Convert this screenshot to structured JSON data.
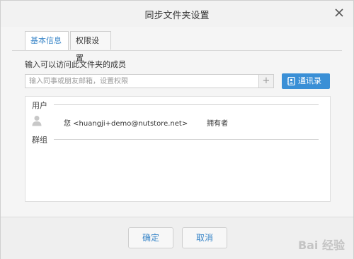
{
  "dialog": {
    "title": "同步文件夹设置",
    "close_icon": "close-icon"
  },
  "tabs": [
    {
      "label": "基本信息",
      "active": true
    },
    {
      "label": "权限设置",
      "active": false
    }
  ],
  "members": {
    "section_label": "输入可以访问此文件夹的成员",
    "input_placeholder": "输入同事或朋友邮箱，设置权限",
    "input_value": "",
    "add_label": "+",
    "contacts_label": "通讯录",
    "contacts_icon": "address-book-icon"
  },
  "list": {
    "users_title": "用户",
    "groups_title": "群组",
    "users": [
      {
        "name": "您 <huangji+demo@nutstore.net>",
        "role": "拥有者",
        "icon": "user-avatar-icon"
      }
    ]
  },
  "footer": {
    "ok_label": "确定",
    "cancel_label": "取消"
  },
  "watermark": {
    "text": "Bai 经验"
  },
  "colors": {
    "accent": "#3a8fd6",
    "tab_active_text": "#3b87c9"
  }
}
